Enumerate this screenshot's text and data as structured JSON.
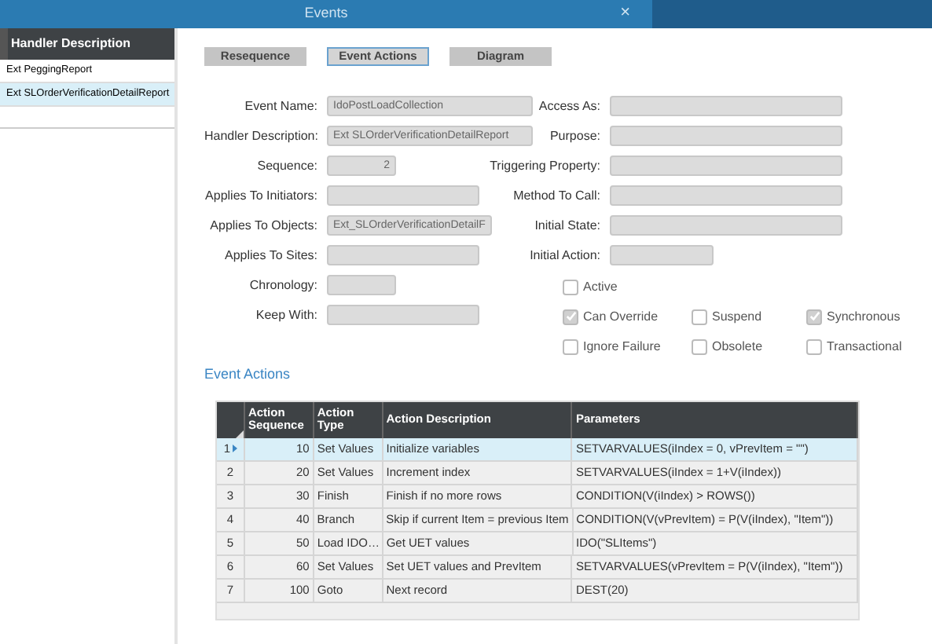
{
  "window": {
    "title": "Events",
    "close": "×"
  },
  "handlers": {
    "column": "Handler Description",
    "items": [
      {
        "label": "Ext PeggingReport",
        "selected": false
      },
      {
        "label": "Ext SLOrderVerificationDetailReport",
        "selected": true
      }
    ]
  },
  "buttons": [
    {
      "label": "Resequence",
      "selected": false
    },
    {
      "label": "Event Actions",
      "selected": true
    },
    {
      "label": "Diagram",
      "selected": false
    }
  ],
  "left_fields": [
    {
      "label": "Event Name:",
      "value": "IdoPostLoadCollection"
    },
    {
      "label": "Handler Description:",
      "value": "Ext SLOrderVerificationDetailReport"
    },
    {
      "label": "Sequence:",
      "value": "2"
    },
    {
      "label": "Applies To Initiators:"
    },
    {
      "label": "Applies To Objects:",
      "value": "Ext_SLOrderVerificationDetailF"
    },
    {
      "label": "Applies To Sites:"
    },
    {
      "label": "Chronology:"
    },
    {
      "label": "Keep With:"
    }
  ],
  "right_fields": [
    {
      "label": "Access As:"
    },
    {
      "label": "Purpose:"
    },
    {
      "label": "Triggering Property:"
    },
    {
      "label": "Method To Call:"
    },
    {
      "label": "Initial State:"
    },
    {
      "label": "Initial Action:"
    }
  ],
  "checkboxes": [
    {
      "label": "Active",
      "checked": false
    },
    {
      "label": "Can Override",
      "checked": true
    },
    {
      "label": "Suspend",
      "checked": false
    },
    {
      "label": "Synchronous",
      "checked": true
    },
    {
      "label": "Ignore Failure",
      "checked": false
    },
    {
      "label": "Obsolete",
      "checked": false
    },
    {
      "label": "Transactional",
      "checked": false
    }
  ],
  "section_title": "Event Actions",
  "table": {
    "columns": [
      "Action Sequence",
      "Action Type",
      "Action Description",
      "Parameters"
    ],
    "rows": [
      {
        "num": "1",
        "selected": true,
        "cells": [
          "10",
          "Set Values",
          "Initialize variables",
          "SETVARVALUES(iIndex = 0, vPrevItem = \"\")"
        ]
      },
      {
        "num": "2",
        "selected": false,
        "cells": [
          "20",
          "Set Values",
          "Increment index",
          "SETVARVALUES(iIndex = 1+V(iIndex))"
        ]
      },
      {
        "num": "3",
        "selected": false,
        "cells": [
          "30",
          "Finish",
          "Finish if no more rows",
          "CONDITION(V(iIndex) > ROWS())"
        ]
      },
      {
        "num": "4",
        "selected": false,
        "cells": [
          "40",
          "Branch",
          "Skip if current Item = previous Item",
          "CONDITION(V(vPrevItem) = P(V(iIndex), \"Item\"))"
        ]
      },
      {
        "num": "5",
        "selected": false,
        "cells": [
          "50",
          "Load IDO…",
          "Get UET values",
          "IDO(\"SLItems\")"
        ]
      },
      {
        "num": "6",
        "selected": false,
        "cells": [
          "60",
          "Set Values",
          "Set UET values and PrevItem",
          "SETVARVALUES(vPrevItem = P(V(iIndex), \"Item\"))"
        ]
      },
      {
        "num": "7",
        "selected": false,
        "cells": [
          "100",
          "Goto",
          "Next record",
          "DEST(20)"
        ]
      }
    ]
  }
}
